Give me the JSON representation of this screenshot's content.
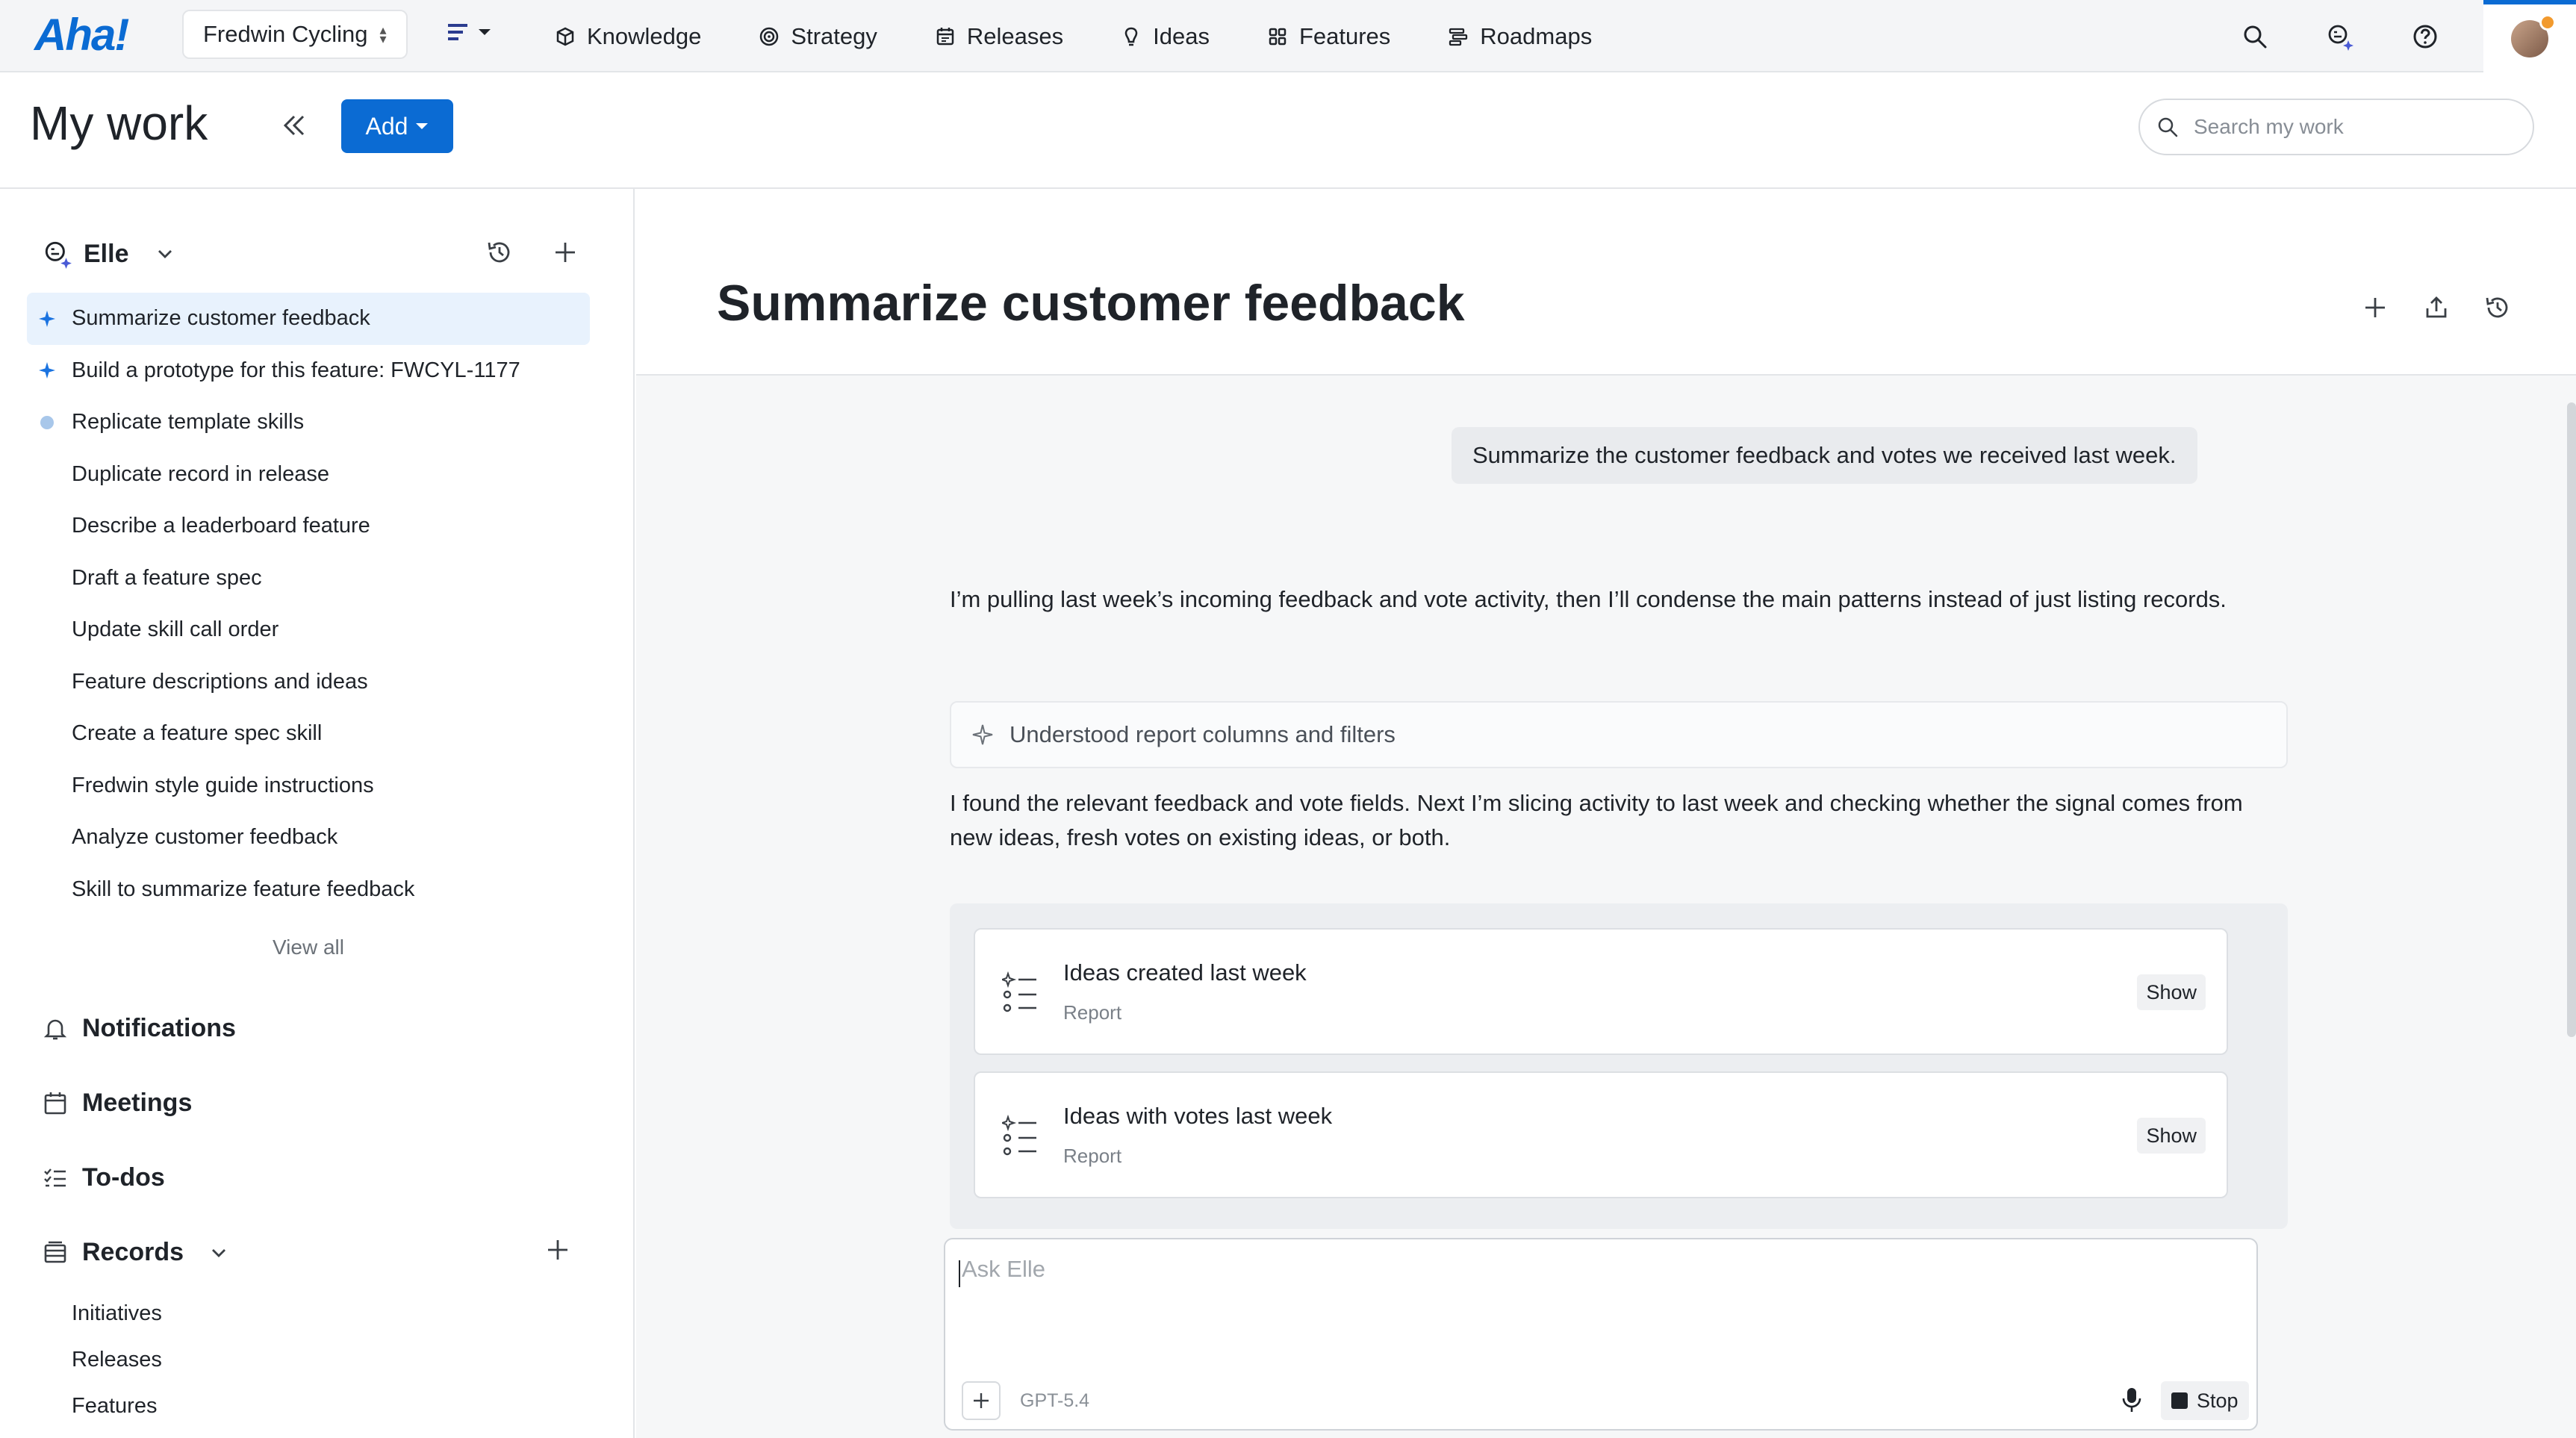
{
  "nav": {
    "logo": "Aha!",
    "workspace": "Fredwin Cycling",
    "items": [
      {
        "label": "Knowledge",
        "icon": "knowledge-icon"
      },
      {
        "label": "Strategy",
        "icon": "target-icon"
      },
      {
        "label": "Releases",
        "icon": "calendar-icon"
      },
      {
        "label": "Ideas",
        "icon": "lightbulb-icon"
      },
      {
        "label": "Features",
        "icon": "grid-icon"
      },
      {
        "label": "Roadmaps",
        "icon": "roadmap-icon"
      }
    ]
  },
  "header": {
    "title": "My work",
    "add_label": "Add",
    "search_placeholder": "Search my work"
  },
  "sidebar": {
    "assistant_name": "Elle",
    "chats": [
      {
        "label": "Summarize customer feedback",
        "marker": "sparkle",
        "active": true
      },
      {
        "label": "Build a prototype for this feature: FWCYL-1177",
        "marker": "sparkle",
        "active": false
      },
      {
        "label": "Replicate template skills",
        "marker": "dot",
        "active": false
      },
      {
        "label": "Duplicate record in release",
        "marker": "none",
        "active": false
      },
      {
        "label": "Describe a leaderboard feature",
        "marker": "none",
        "active": false
      },
      {
        "label": "Draft a feature spec",
        "marker": "none",
        "active": false
      },
      {
        "label": "Update skill call order",
        "marker": "none",
        "active": false
      },
      {
        "label": "Feature descriptions and ideas",
        "marker": "none",
        "active": false
      },
      {
        "label": "Create a feature spec skill",
        "marker": "none",
        "active": false
      },
      {
        "label": "Fredwin style guide instructions",
        "marker": "none",
        "active": false
      },
      {
        "label": "Analyze customer feedback",
        "marker": "none",
        "active": false
      },
      {
        "label": "Skill to summarize feature feedback",
        "marker": "none",
        "active": false
      }
    ],
    "view_all": "View all",
    "notifications": "Notifications",
    "meetings": "Meetings",
    "todos": "To-dos",
    "records": "Records",
    "record_items": [
      "Initiatives",
      "Releases",
      "Features"
    ]
  },
  "chat": {
    "title": "Summarize customer feedback",
    "user_message": "Summarize the customer feedback and votes we received last week.",
    "para1": "I’m pulling last week’s incoming feedback and vote activity, then I’ll condense the main patterns instead of just listing records.",
    "reasoning": "Understood report columns and filters",
    "para2": "I found the relevant feedback and vote fields. Next I’m slicing activity to last week and checking whether the signal comes from new ideas, fresh votes on existing ideas, or both.",
    "reports": [
      {
        "title": "Ideas created last week",
        "subtitle": "Report",
        "action": "Show"
      },
      {
        "title": "Ideas with votes last week",
        "subtitle": "Report",
        "action": "Show"
      }
    ],
    "composer": {
      "placeholder": "Ask Elle",
      "model": "GPT-5.4",
      "stop_label": "Stop"
    }
  },
  "colors": {
    "brand": "#0b6bd3",
    "active_bg": "#e8f2fd",
    "notification_dot": "#f29a2e"
  }
}
